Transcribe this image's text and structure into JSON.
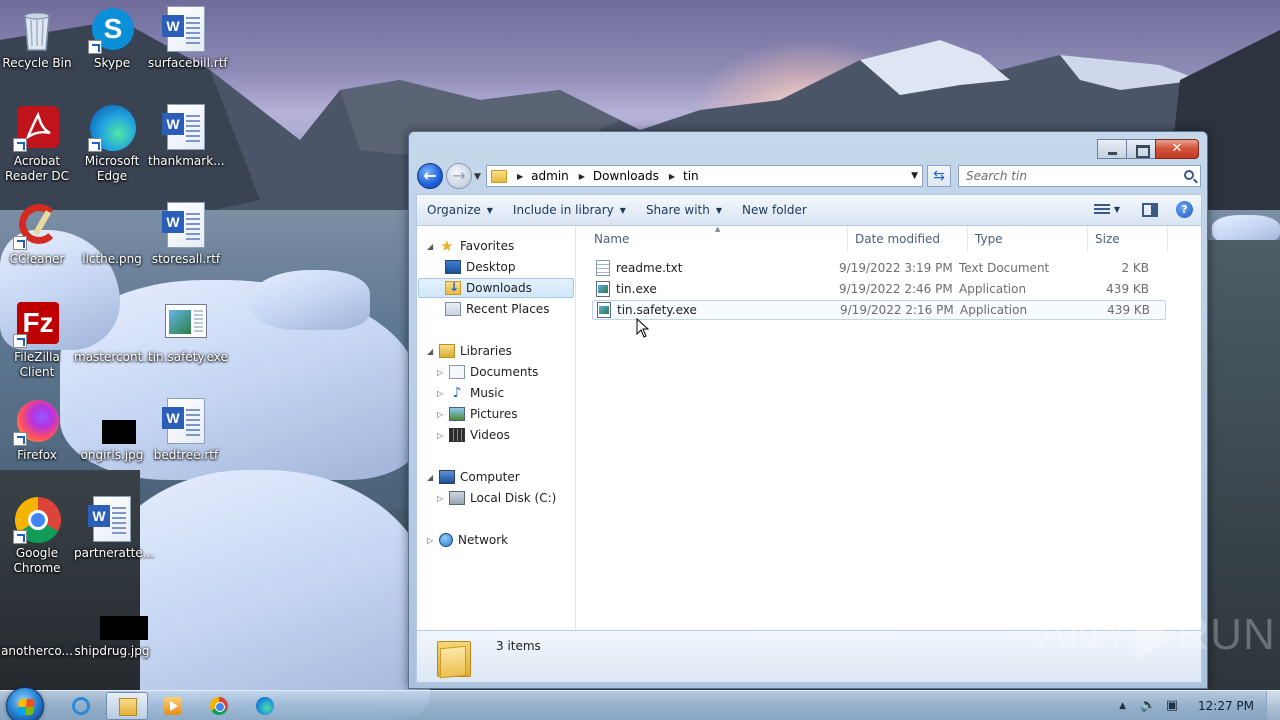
{
  "desktop": {
    "icons": [
      {
        "label": "Recycle Bin"
      },
      {
        "label": "Skype"
      },
      {
        "label": "surfacebill.rtf"
      },
      {
        "label": "Acrobat Reader DC"
      },
      {
        "label": "Microsoft Edge"
      },
      {
        "label": "thankmark..."
      },
      {
        "label": "CCleaner"
      },
      {
        "label": "llcthe.png"
      },
      {
        "label": "storesall.rtf"
      },
      {
        "label": "FileZilla Client"
      },
      {
        "label": "mastercont..."
      },
      {
        "label": "tin.safety.exe"
      },
      {
        "label": "Firefox"
      },
      {
        "label": "ongirls.jpg"
      },
      {
        "label": "bedtree.rtf"
      },
      {
        "label": "Google Chrome"
      },
      {
        "label": "partneratte..."
      },
      {
        "label": "anotherco..."
      },
      {
        "label": "shipdrug.jpg"
      }
    ]
  },
  "window": {
    "close_glyph": "✕",
    "breadcrumb": [
      "admin",
      "Downloads",
      "tin"
    ],
    "search_placeholder": "Search tin",
    "toolbar": {
      "organize": "Organize",
      "include_in_library": "Include in library",
      "share_with": "Share with",
      "new_folder": "New folder"
    },
    "nav": {
      "favorites": "Favorites",
      "desktop": "Desktop",
      "downloads": "Downloads",
      "recent_places": "Recent Places",
      "libraries": "Libraries",
      "documents": "Documents",
      "music": "Music",
      "pictures": "Pictures",
      "videos": "Videos",
      "computer": "Computer",
      "local_disk": "Local Disk (C:)",
      "network": "Network"
    },
    "columns": {
      "name": "Name",
      "date_modified": "Date modified",
      "type": "Type",
      "size": "Size"
    },
    "files": [
      {
        "name": "readme.txt",
        "date": "9/19/2022 3:19 PM",
        "type": "Text Document",
        "size": "2 KB",
        "icon": "text-file-icon"
      },
      {
        "name": "tin.exe",
        "date": "9/19/2022 2:46 PM",
        "type": "Application",
        "size": "439 KB",
        "icon": "application-icon"
      },
      {
        "name": "tin.safety.exe",
        "date": "9/19/2022 2:16 PM",
        "type": "Application",
        "size": "439 KB",
        "icon": "application-icon"
      }
    ],
    "status": {
      "item_count": "3 items"
    }
  },
  "watermark": {
    "left": "ANY",
    "right": "RUN"
  },
  "taskbar": {
    "clock": "12:27 PM",
    "pinned": [
      "internet-explorer",
      "windows-explorer",
      "windows-media-player",
      "google-chrome",
      "microsoft-edge"
    ],
    "active": "windows-explorer"
  }
}
